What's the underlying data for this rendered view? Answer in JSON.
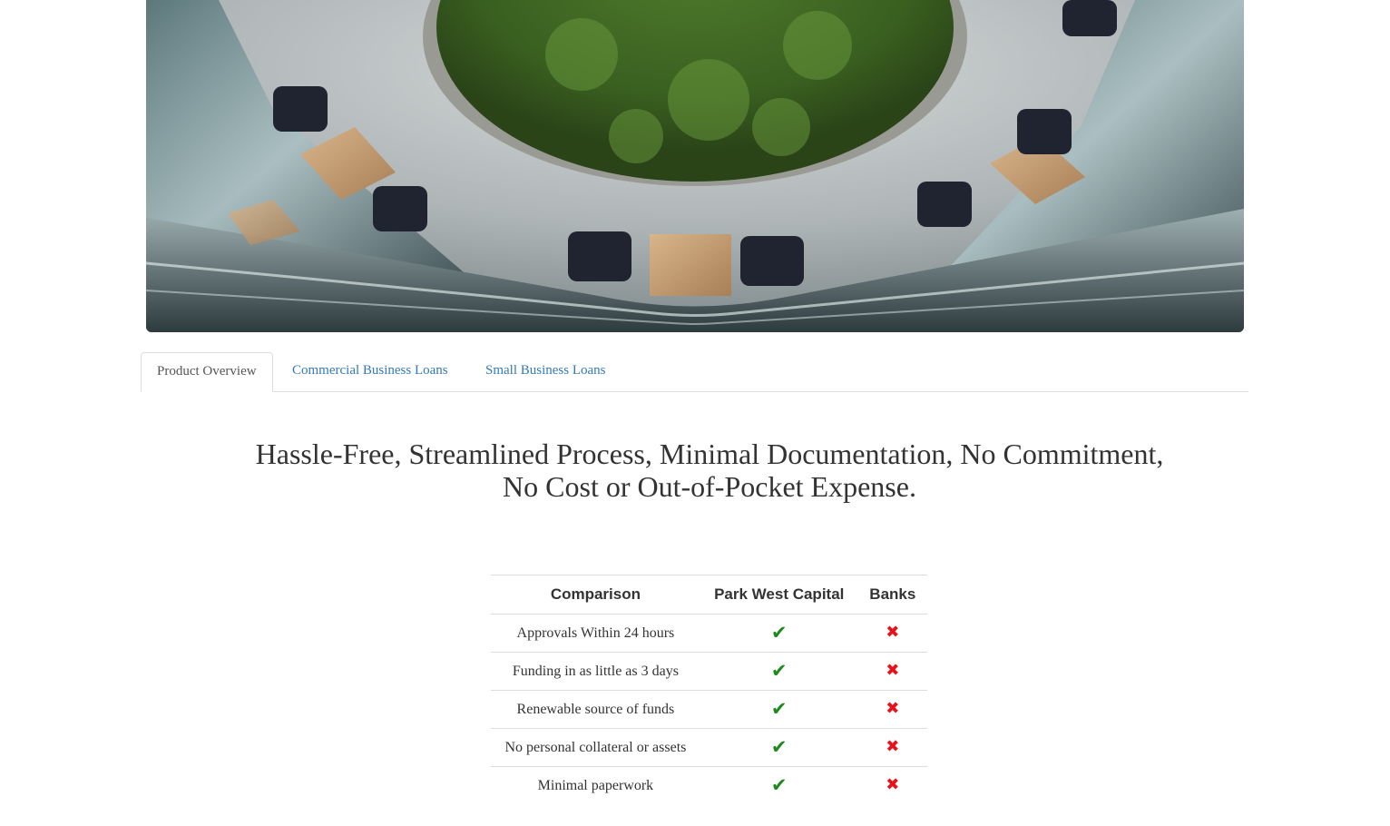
{
  "hero": {
    "description_icon": "hero-photo"
  },
  "tabs": [
    {
      "label": "Product Overview",
      "active": true
    },
    {
      "label": "Commercial Business Loans",
      "active": false
    },
    {
      "label": "Small Business Loans",
      "active": false
    }
  ],
  "headline": "Hassle-Free, Streamlined Process, Minimal Documentation, No Commitment, No Cost or Out-of-Pocket Expense.",
  "comparison": {
    "headers": [
      "Comparison",
      "Park West Capital",
      "Banks"
    ],
    "rows": [
      {
        "feature": "Approvals Within 24 hours",
        "pwc": "✔",
        "banks": "✖"
      },
      {
        "feature": "Funding in as little as 3 days",
        "pwc": "✔",
        "banks": "✖"
      },
      {
        "feature": "Renewable source of funds",
        "pwc": "✔",
        "banks": "✖"
      },
      {
        "feature": "No personal collateral or assets",
        "pwc": "✔",
        "banks": "✖"
      },
      {
        "feature": "Minimal paperwork",
        "pwc": "✔",
        "banks": "✖"
      }
    ],
    "colors": {
      "check": "#1e8a1e",
      "cross": "#e8121d"
    }
  },
  "colors": {
    "link": "#337ab7",
    "text": "#333333",
    "border": "#dddddd"
  }
}
